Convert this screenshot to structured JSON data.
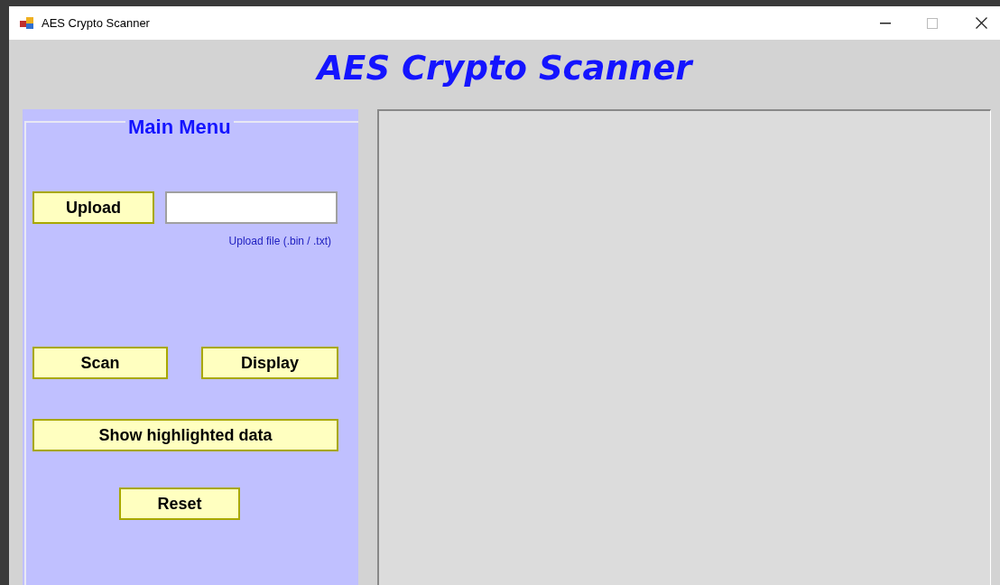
{
  "window": {
    "title": "AES Crypto Scanner"
  },
  "heading": "AES Crypto Scanner",
  "main_menu": {
    "title": "Main Menu",
    "upload_button": "Upload",
    "upload_hint": "Upload file (.bin / .txt)",
    "scan_button": "Scan",
    "display_button": "Display",
    "highlight_button": "Show highlighted data",
    "reset_button": "Reset"
  }
}
